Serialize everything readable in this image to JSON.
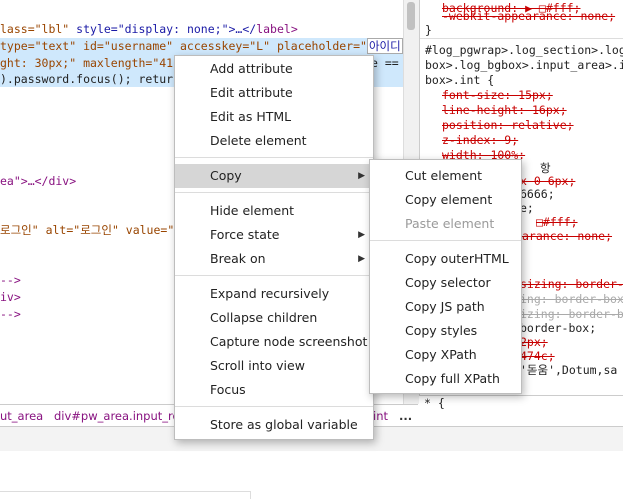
{
  "elements_panel": {
    "lines": [
      {
        "a": "lass=\"lbl\" ",
        "b": "style=\"display: none;\">…</",
        "c": "label",
        "d": ">"
      },
      {
        "a": " type=\"text\" id=\"username\" accesskey=\"L\" placeholder=\"",
        "b": "아이디",
        "c": "\""
      },
      {
        "a": "ght: 30px;\" maxlength=\"41\"",
        "b": "e =="
      },
      {
        "a": ").password.focus(); return"
      },
      {
        "a": "ea\">…</div>"
      },
      {
        "a": "로그인\" alt=\"로그인\" value=\""
      },
      {
        "a": "-->"
      },
      {
        "a": "iv>"
      },
      {
        "a": "-->"
      }
    ]
  },
  "styles_panel": {
    "lines": [
      "background: ▶ □#fff;",
      "-webkit-appearance: none;",
      "}",
      "#log_pgwrap>.log_section>.log",
      "box>.log_bgbox>.input_area>.in",
      "box>.int {",
      "font-size: 15px;",
      "line-height: 16px;",
      "position: relative;",
      "z-index: 9;",
      "width: 100%;",
      "항",
      "x 0 6px;",
      "6666;",
      "e;",
      "□#fff;",
      "arance: none;",
      "sizing: border-b",
      "ing: border-box",
      "izing: border-box",
      "border-box;",
      "2px;",
      "474c;",
      "'돋움',Dotum,sa",
      "* {"
    ]
  },
  "breadcrumbs": {
    "item1": "ut_area",
    "item2": "div#pw_area.input_row",
    "item3": "int",
    "more": "..."
  },
  "context_menu": {
    "items": [
      {
        "label": "Add attribute"
      },
      {
        "label": "Edit attribute"
      },
      {
        "label": "Edit as HTML"
      },
      {
        "label": "Delete element"
      },
      {
        "label": "Copy"
      },
      {
        "label": "Hide element"
      },
      {
        "label": "Force state"
      },
      {
        "label": "Break on"
      },
      {
        "label": "Expand recursively"
      },
      {
        "label": "Collapse children"
      },
      {
        "label": "Capture node screenshot"
      },
      {
        "label": "Scroll into view"
      },
      {
        "label": "Focus"
      },
      {
        "label": "Store as global variable"
      }
    ]
  },
  "copy_submenu": {
    "items": [
      {
        "label": "Cut element"
      },
      {
        "label": "Copy element"
      },
      {
        "label": "Paste element"
      },
      {
        "label": "Copy outerHTML"
      },
      {
        "label": "Copy selector"
      },
      {
        "label": "Copy JS path"
      },
      {
        "label": "Copy styles"
      },
      {
        "label": "Copy XPath"
      },
      {
        "label": "Copy full XPath"
      }
    ]
  },
  "colors": {
    "selected_row": "#cfe8fc",
    "menu_hover": "#d6d6d6",
    "attr_name": "#994500",
    "attr_value": "#1a1aa6",
    "tag": "#881280",
    "strike": "#c80000"
  },
  "icons": {
    "submenu_arrow": "chevron-right-icon"
  }
}
